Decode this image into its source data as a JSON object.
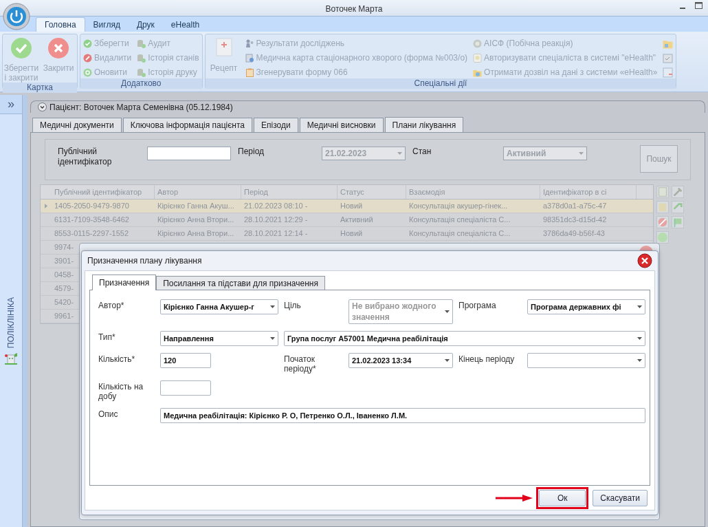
{
  "window": {
    "title": "Воточек Марта"
  },
  "ribbon": {
    "tabs": [
      {
        "label": "Головна",
        "selected": true
      },
      {
        "label": "Вигляд",
        "selected": false
      },
      {
        "label": "Друк",
        "selected": false
      },
      {
        "label": "eHealth",
        "selected": false
      }
    ],
    "groups": [
      {
        "title": "Картка",
        "large": [
          "Зберегти і закрити",
          "Закрити"
        ]
      },
      {
        "title": "Додатково",
        "columns": [
          [
            "Зберегти",
            "Видалити",
            "Оновити"
          ],
          [
            "Аудит",
            "Історія станів",
            "Історія друку"
          ]
        ]
      },
      {
        "title": "Спеціальні дії",
        "large": [
          "Рецепт"
        ],
        "columns": [
          [
            "Результати досліджень",
            "Медична карта стаціонарного хворого (форма №003/о)",
            "Згенерувати форму 066"
          ],
          [
            "АІСФ (Побічна реакція)",
            "Авторизувати спеціаліста в системі \"eHealth\"",
            "Отримати дозвіл на дані з системи «eHealth»"
          ]
        ]
      }
    ]
  },
  "sidebar": {
    "toggle": "»",
    "label": "ПОЛІКЛІНІКА"
  },
  "patient_header": "Пацієнт: Воточек Марта Семенівна (05.12.1984)",
  "tabs": [
    {
      "label": "Медичні документи",
      "selected": false
    },
    {
      "label": "Ключова інформація пацієнта",
      "selected": false
    },
    {
      "label": "Епізоди",
      "selected": false
    },
    {
      "label": "Медичні висновки",
      "selected": false
    },
    {
      "label": "Плани лікування",
      "selected": true
    }
  ],
  "filter": {
    "fields": [
      {
        "label": "Публічний ідентифікатор",
        "kind": "text"
      },
      {
        "label": "Період",
        "value": "21.02.2023",
        "kind": "dropdown"
      },
      {
        "label": "Стан",
        "value": "Активний",
        "kind": "dropdown"
      }
    ],
    "button": "Пошук"
  },
  "table": {
    "columns": [
      "Публічний ідентифікатор",
      "Автор",
      "Період",
      "Статус",
      "Взаємодія",
      "Ідентифікатор в сі"
    ],
    "rows": [
      {
        "selected": true,
        "cells": [
          "1405-2050-9479-9870",
          "Кірієнко Ганна Акуш...",
          "21.02.2023 08:10 -",
          "Новий",
          "Консультація акушер-гінек...",
          "a378d0a1-a75c-47"
        ]
      },
      {
        "selected": false,
        "cells": [
          "6131-7109-3548-6462",
          "Кірієнко Анна Втори...",
          "28.10.2021 12:29 -",
          "Активний",
          "Консультація спеціаліста С...",
          "98351dc3-d15d-42"
        ]
      },
      {
        "selected": false,
        "cells": [
          "8553-0115-2297-1552",
          "Кірієнко Анна Втори...",
          "28.10.2021 12:14 -",
          "Новий",
          "Консультація спеціаліста С...",
          "3786da49-b56f-43"
        ]
      },
      {
        "selected": false,
        "cells": [
          "9974-"
        ]
      },
      {
        "selected": false,
        "cells": [
          "3901-"
        ]
      },
      {
        "selected": false,
        "cells": [
          "0458-"
        ]
      },
      {
        "selected": false,
        "cells": [
          "4579-"
        ]
      },
      {
        "selected": false,
        "cells": [
          "5420-"
        ]
      },
      {
        "selected": false,
        "cells": [
          "9961-"
        ]
      }
    ]
  },
  "dialog": {
    "title": "Призначення плану лікування",
    "tabs": [
      {
        "label": "Призначення",
        "selected": true
      },
      {
        "label": "Посилання та підстави для призначення",
        "selected": false
      }
    ],
    "fields": [
      {
        "label": "Автор*",
        "value": "Кірієнко Ганна Акушер-г",
        "kind": "dropdown"
      },
      {
        "label": "Ціль",
        "placeholder": "Не вибрано жодного значення",
        "kind": "dropdown"
      },
      {
        "label": "Програма",
        "value": "Програма державних фі",
        "kind": "dropdown"
      },
      {
        "label": "Тип*",
        "value": "Направлення",
        "kind": "dropdown"
      },
      {
        "value": "Група послуг А57001 Медична реабілітація",
        "kind": "dropdown"
      },
      {
        "label": "Кількість*",
        "value": "120",
        "kind": "text"
      },
      {
        "label": "Початок періоду*",
        "value": "21.02.2023 13:34",
        "kind": "dropdown"
      },
      {
        "label": "Кінець періоду",
        "kind": "dropdown"
      },
      {
        "label": "Кількість на добу",
        "kind": "text"
      },
      {
        "label": "Опис",
        "value": "Медична реабілітація: Кірієнко Р. О, Петренко О.Л., Іваненко Л.М.",
        "kind": "text"
      }
    ],
    "buttons": [
      {
        "label": "Ок",
        "highlighted": true
      },
      {
        "label": "Скасувати",
        "highlighted": false
      }
    ]
  }
}
